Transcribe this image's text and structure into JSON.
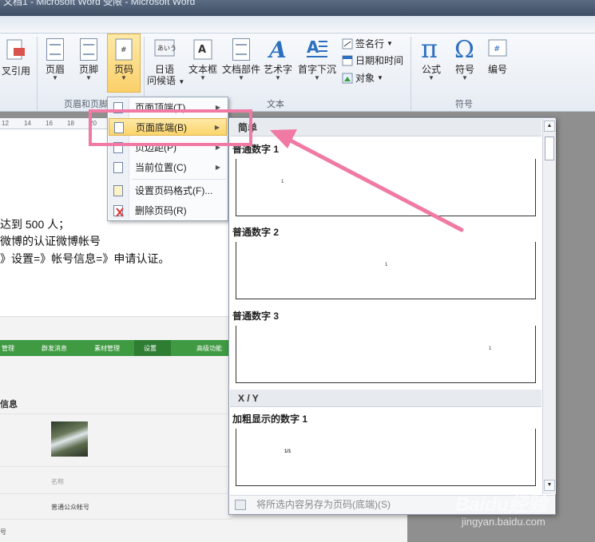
{
  "window": {
    "title": "文档1 - Microsoft Word 受限 - Microsoft Word"
  },
  "ribbon": {
    "buttons": {
      "cross_ref": "叉引用",
      "header": "页眉",
      "footer": "页脚",
      "page_number": "页码",
      "greeting_line1": "日语",
      "greeting_line2": "问候语",
      "textbox": "文本框",
      "quick_parts": "文档部件",
      "wordart": "艺术字",
      "drop_cap": "首字下沉",
      "signature": "签名行",
      "datetime": "日期和时间",
      "object": "对象",
      "equation": "公式",
      "symbol": "符号",
      "number": "编号"
    },
    "groups": {
      "header_footer": "页眉和页脚",
      "text": "文本",
      "symbols": "符号"
    }
  },
  "menu": {
    "items": [
      {
        "label": "页面顶端(T)",
        "has_submenu": true
      },
      {
        "label": "页面底端(B)",
        "has_submenu": true,
        "highlighted": true
      },
      {
        "label": "页边距(P)",
        "has_submenu": true
      },
      {
        "label": "当前位置(C)",
        "has_submenu": true
      },
      {
        "label": "设置页码格式(F)...",
        "has_submenu": false
      },
      {
        "label": "删除页码(R)",
        "has_submenu": false
      }
    ]
  },
  "gallery": {
    "section_simple": "简单",
    "section_xy": "X / Y",
    "items": [
      {
        "title": "普通数字 1",
        "sample": "1"
      },
      {
        "title": "普通数字 2",
        "sample": "1"
      },
      {
        "title": "普通数字 3",
        "sample": "1"
      },
      {
        "title": "加粗显示的数字 1",
        "sample": "1/1"
      }
    ],
    "footer": "将所选内容另存为页码(底端)(S)"
  },
  "document": {
    "ruler_ticks": [
      "12",
      "14",
      "16",
      "18",
      "20"
    ],
    "lines": [
      "达到 500 人；",
      "微博的认证微博帐号",
      "》设置=》帐号信息=》申请认证。"
    ],
    "embedded": {
      "nav": [
        "管理",
        "群发消息",
        "素材管理",
        "设置",
        "高级功能"
      ],
      "info_heading": "信息",
      "rows": [
        "名称",
        "普通公众帐号",
        "号"
      ]
    }
  },
  "colors": {
    "highlight_box": "#f07aa3",
    "menu_highlight": "#fcd46a",
    "nav_green": "#3f9a41"
  },
  "watermark": {
    "brand": "Baidu经验",
    "url": "jingyan.baidu.com"
  }
}
